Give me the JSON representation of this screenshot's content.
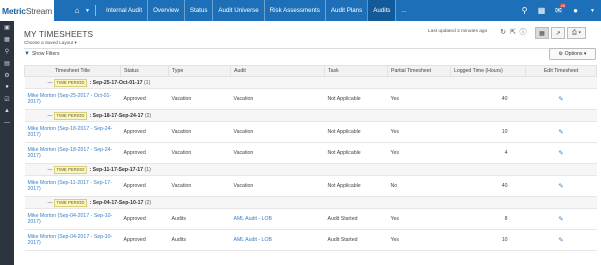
{
  "brand": {
    "part1": "Metric",
    "part2": "Stream"
  },
  "nav": {
    "home_icon": "home-icon",
    "items": [
      {
        "label": "Internal Audit"
      },
      {
        "label": "Overview"
      },
      {
        "label": "Status"
      },
      {
        "label": "Audit Universe"
      },
      {
        "label": "Risk Assessments"
      },
      {
        "label": "Audit Plans"
      },
      {
        "label": "Audits",
        "active": true
      },
      {
        "label": "..."
      }
    ],
    "notification_count": "45"
  },
  "page": {
    "title": "MY TIMESHEETS",
    "saved_layout": "Choose a Saved Layout",
    "last_updated": "Last updated 2 minutes ago",
    "show_filters": "Show Filters",
    "options": "Options"
  },
  "table": {
    "columns": [
      "Timesheet Title",
      "Status",
      "Type",
      "Audit",
      "Task",
      "Partial Timesheet",
      "Logged Time (Hours)",
      "Edit Timesheet"
    ],
    "time_period_label": "TIME PERIOD",
    "groups": [
      {
        "period": ": Sep-25-17-Oct-01-17",
        "count": "(1)",
        "rows": [
          {
            "title": "Mike Morton (Sep-25-2017 - Oct-01-2017)",
            "status": "Approved",
            "type": "Vacation",
            "audit": "Vacation",
            "audit_link": false,
            "task": "Not Applicable",
            "partial": "Yes",
            "hours": "40"
          }
        ]
      },
      {
        "period": ": Sep-18-17-Sep-24-17",
        "count": "(2)",
        "rows": [
          {
            "title": "Mike Morton (Sep-18-2017 - Sep-24-2017)",
            "status": "Approved",
            "type": "Vacation",
            "audit": "Vacation",
            "audit_link": false,
            "task": "Not Applicable",
            "partial": "Yes",
            "hours": "10"
          },
          {
            "title": "Mike Morton (Sep-18-2017 - Sep-24-2017)",
            "status": "Approved",
            "type": "Vacation",
            "audit": "Vacation",
            "audit_link": false,
            "task": "Not Applicable",
            "partial": "Yes",
            "hours": "4"
          }
        ]
      },
      {
        "period": ": Sep-11-17-Sep-17-17",
        "count": "(1)",
        "rows": [
          {
            "title": "Mike Morton (Sep-11-2017 - Sep-17-2017)",
            "status": "Approved",
            "type": "Vacation",
            "audit": "Vacation",
            "audit_link": false,
            "task": "Not Applicable",
            "partial": "No",
            "hours": "40"
          }
        ]
      },
      {
        "period": ": Sep-04-17-Sep-10-17",
        "count": "(2)",
        "rows": [
          {
            "title": "Mike Morton (Sep-04-2017 - Sep-10-2017)",
            "status": "Approved",
            "type": "Audits",
            "audit": "AML Audit - LOB",
            "audit_link": true,
            "task": "Audit Started",
            "partial": "Yes",
            "hours": "8"
          },
          {
            "title": "Mike Morton (Sep-04-2017 - Sep-10-2017)",
            "status": "Approved",
            "type": "Audits",
            "audit": "AML Audit - LOB",
            "audit_link": true,
            "task": "Audit Started",
            "partial": "Yes",
            "hours": "10"
          }
        ]
      }
    ]
  },
  "colors": {
    "topbar": "#1d70b7",
    "link": "#3a7fc4",
    "sidebar": "#2d3440"
  }
}
